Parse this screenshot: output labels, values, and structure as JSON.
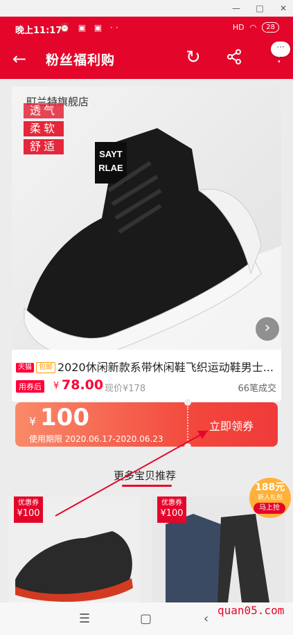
{
  "status_bar": {
    "time": "晚上11:17",
    "network": "HD",
    "battery": "28"
  },
  "app_bar": {
    "title": "粉丝福利购",
    "back_icon": "arrow-left-icon",
    "refresh_icon": "refresh-icon",
    "share_icon": "share-icon",
    "more_icon": "more-vertical-icon"
  },
  "product": {
    "shop": "町兰特旗舰店",
    "image_tags": [
      "透气",
      "柔软",
      "舒适"
    ],
    "shoe_text": [
      "SAYT",
      "RLAE"
    ],
    "badges": [
      "天猫",
      "包邮"
    ],
    "title": "2020休闲新款系带休闲鞋飞织运动鞋男士...",
    "coupon_after_label": "用券后",
    "price_symbol": "¥",
    "price": "78.00",
    "original_price": "现价¥178",
    "sold": "66笔成交"
  },
  "coupon": {
    "symbol": "¥",
    "amount": "100",
    "period": "使用期限 2020.06.17-2020.06.23",
    "claim": "立即领券"
  },
  "more_section": {
    "title": "更多宝贝推荐"
  },
  "recommendations": [
    {
      "tag_line1": "优惠券",
      "tag_line2": "¥100"
    },
    {
      "tag_line1": "优惠券",
      "tag_line2": "¥100"
    }
  ],
  "float_ad": {
    "amount": "188元",
    "subtitle": "新人礼包",
    "button": "马上抢"
  },
  "watermark": "quan05.com",
  "colors": {
    "brand_red": "#e4062a",
    "price_red": "#ff0036",
    "coupon_gradient_start": "#fa8a69",
    "coupon_gradient_end": "#f03a39"
  }
}
